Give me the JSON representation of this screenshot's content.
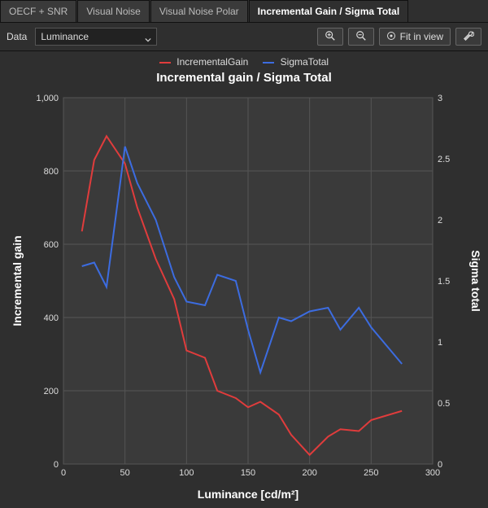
{
  "tabs": [
    {
      "label": "OECF + SNR",
      "active": false
    },
    {
      "label": "Visual Noise",
      "active": false
    },
    {
      "label": "Visual Noise Polar",
      "active": false
    },
    {
      "label": "Incremental Gain / Sigma Total",
      "active": true
    }
  ],
  "toolbar": {
    "data_label": "Data",
    "data_value": "Luminance",
    "fit_label": "Fit in view"
  },
  "legend": {
    "series1": {
      "name": "IncrementalGain",
      "color": "#e03c3c"
    },
    "series2": {
      "name": "SigmaTotal",
      "color": "#3c6ce0"
    }
  },
  "chart_data": {
    "type": "line",
    "title": "Incremental gain / Sigma Total",
    "xlabel": "Luminance [cd/m²]",
    "ylabel_left": "Incremental gain",
    "ylabel_right": "Sigma total",
    "xlim": [
      0,
      300
    ],
    "ylim_left": [
      0,
      1000
    ],
    "ylim_right": [
      0,
      3
    ],
    "xticks": [
      0,
      50,
      100,
      150,
      200,
      250,
      300
    ],
    "yticks_left": [
      0,
      200,
      400,
      600,
      800,
      1000
    ],
    "yticks_right": [
      0,
      0.5,
      1,
      1.5,
      2,
      2.5,
      3
    ],
    "x": [
      15,
      25,
      35,
      50,
      60,
      75,
      90,
      100,
      115,
      125,
      140,
      150,
      160,
      175,
      185,
      200,
      215,
      225,
      240,
      250,
      260,
      275
    ],
    "series": [
      {
        "name": "IncrementalGain",
        "axis": "left",
        "color": "#e03c3c",
        "values": [
          635,
          830,
          895,
          820,
          700,
          560,
          450,
          310,
          290,
          200,
          180,
          155,
          170,
          135,
          80,
          25,
          75,
          95,
          90,
          120,
          130,
          145
        ]
      },
      {
        "name": "SigmaTotal",
        "axis": "right",
        "color": "#3c6ce0",
        "values": [
          1.62,
          1.65,
          1.45,
          2.6,
          2.3,
          2.0,
          1.53,
          1.33,
          1.3,
          1.55,
          1.5,
          1.1,
          0.75,
          1.2,
          1.17,
          1.25,
          1.28,
          1.1,
          1.28,
          1.12,
          1.0,
          0.82
        ]
      }
    ]
  }
}
